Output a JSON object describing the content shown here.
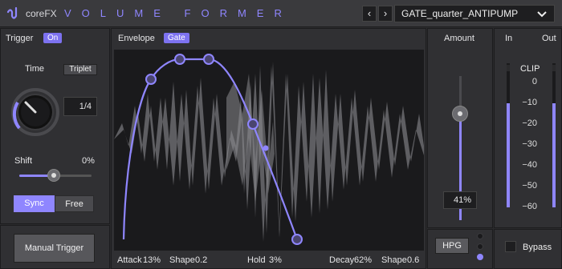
{
  "header": {
    "brand": "coreFX",
    "product": "VOLUME FORMER",
    "prev_label": "‹",
    "next_label": "›",
    "preset": "GATE_quarter_ANTIPUMP"
  },
  "trigger": {
    "title": "Trigger",
    "state": "On",
    "time_label": "Time",
    "triplet": "Triplet",
    "time_value": "1/4",
    "shift_label": "Shift",
    "shift_value": "0%",
    "shift_level": 0.5,
    "sync": "Sync",
    "free": "Free",
    "manual": "Manual Trigger"
  },
  "envelope": {
    "title": "Envelope",
    "mode": "Gate",
    "params": [
      {
        "label": "Attack",
        "value": "13%"
      },
      {
        "label": "Shape",
        "value": "0.2"
      },
      {
        "label": "Hold",
        "value": "3%"
      },
      {
        "label": "Decay",
        "value": "62%"
      },
      {
        "label": "Shape",
        "value": "0.6"
      }
    ]
  },
  "amount": {
    "title": "Amount",
    "value": "41%",
    "level": 0.41,
    "hpg": "HPG"
  },
  "meters": {
    "in_label": "In",
    "out_label": "Out",
    "clip": "CLIP",
    "scale": [
      "0",
      "−10",
      "−20",
      "−30",
      "−40",
      "−50",
      "−60"
    ],
    "bypass": "Bypass"
  },
  "colors": {
    "accent": "#8f86ff",
    "pill": "#7d72f0",
    "panel": "#303033",
    "background": "#2b2b2d"
  }
}
